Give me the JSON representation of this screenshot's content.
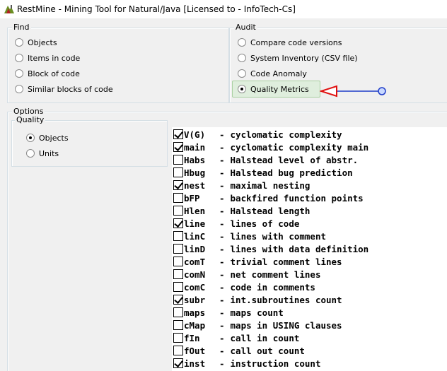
{
  "window": {
    "title": "RestMine - Mining Tool for Natural/Java [Licensed to  - InfoTech-Cs]"
  },
  "find": {
    "legend": "Find",
    "options": [
      "Objects",
      "Items in code",
      "Block of code",
      "Similar blocks of code"
    ]
  },
  "audit": {
    "legend": "Audit",
    "options": [
      "Compare code versions",
      "System Inventory (CSV file)",
      "Code Anomaly",
      "Quality Metrics"
    ],
    "selected": "Quality Metrics"
  },
  "options": {
    "legend": "Options",
    "quality": {
      "legend": "Quality",
      "options": [
        "Objects",
        "Units"
      ],
      "selected": "Objects"
    }
  },
  "metrics": [
    {
      "code": "V(G)",
      "desc": "cyclomatic complexity",
      "checked": true
    },
    {
      "code": "main",
      "desc": "cyclomatic complexity main",
      "checked": true
    },
    {
      "code": "Habs",
      "desc": "Halstead level of abstr.",
      "checked": false
    },
    {
      "code": "Hbug",
      "desc": "Halstead bug prediction",
      "checked": false
    },
    {
      "code": "nest",
      "desc": "maximal nesting",
      "checked": true
    },
    {
      "code": "bFP",
      "desc": "backfired function points",
      "checked": false
    },
    {
      "code": "Hlen",
      "desc": "Halstead length",
      "checked": false
    },
    {
      "code": "line",
      "desc": "lines of code",
      "checked": true
    },
    {
      "code": "linC",
      "desc": "lines with comment",
      "checked": false
    },
    {
      "code": "linD",
      "desc": "lines with data definition",
      "checked": false
    },
    {
      "code": "comT",
      "desc": "trivial comment lines",
      "checked": false
    },
    {
      "code": "comN",
      "desc": "net comment lines",
      "checked": false
    },
    {
      "code": "comC",
      "desc": "code in comments",
      "checked": false
    },
    {
      "code": "subr",
      "desc": "int.subroutines count",
      "checked": true
    },
    {
      "code": "maps",
      "desc": "maps count",
      "checked": false
    },
    {
      "code": "cMap",
      "desc": "maps in USING clauses",
      "checked": false
    },
    {
      "code": "fIn",
      "desc": "call in count",
      "checked": false
    },
    {
      "code": "fOut",
      "desc": "call out count",
      "checked": false
    },
    {
      "code": "inst",
      "desc": "instruction count",
      "checked": true
    }
  ],
  "colors": {
    "annotation": "#1e3cc8",
    "highlight": "#dfeedd",
    "client_bg": "#f0f0f0"
  }
}
